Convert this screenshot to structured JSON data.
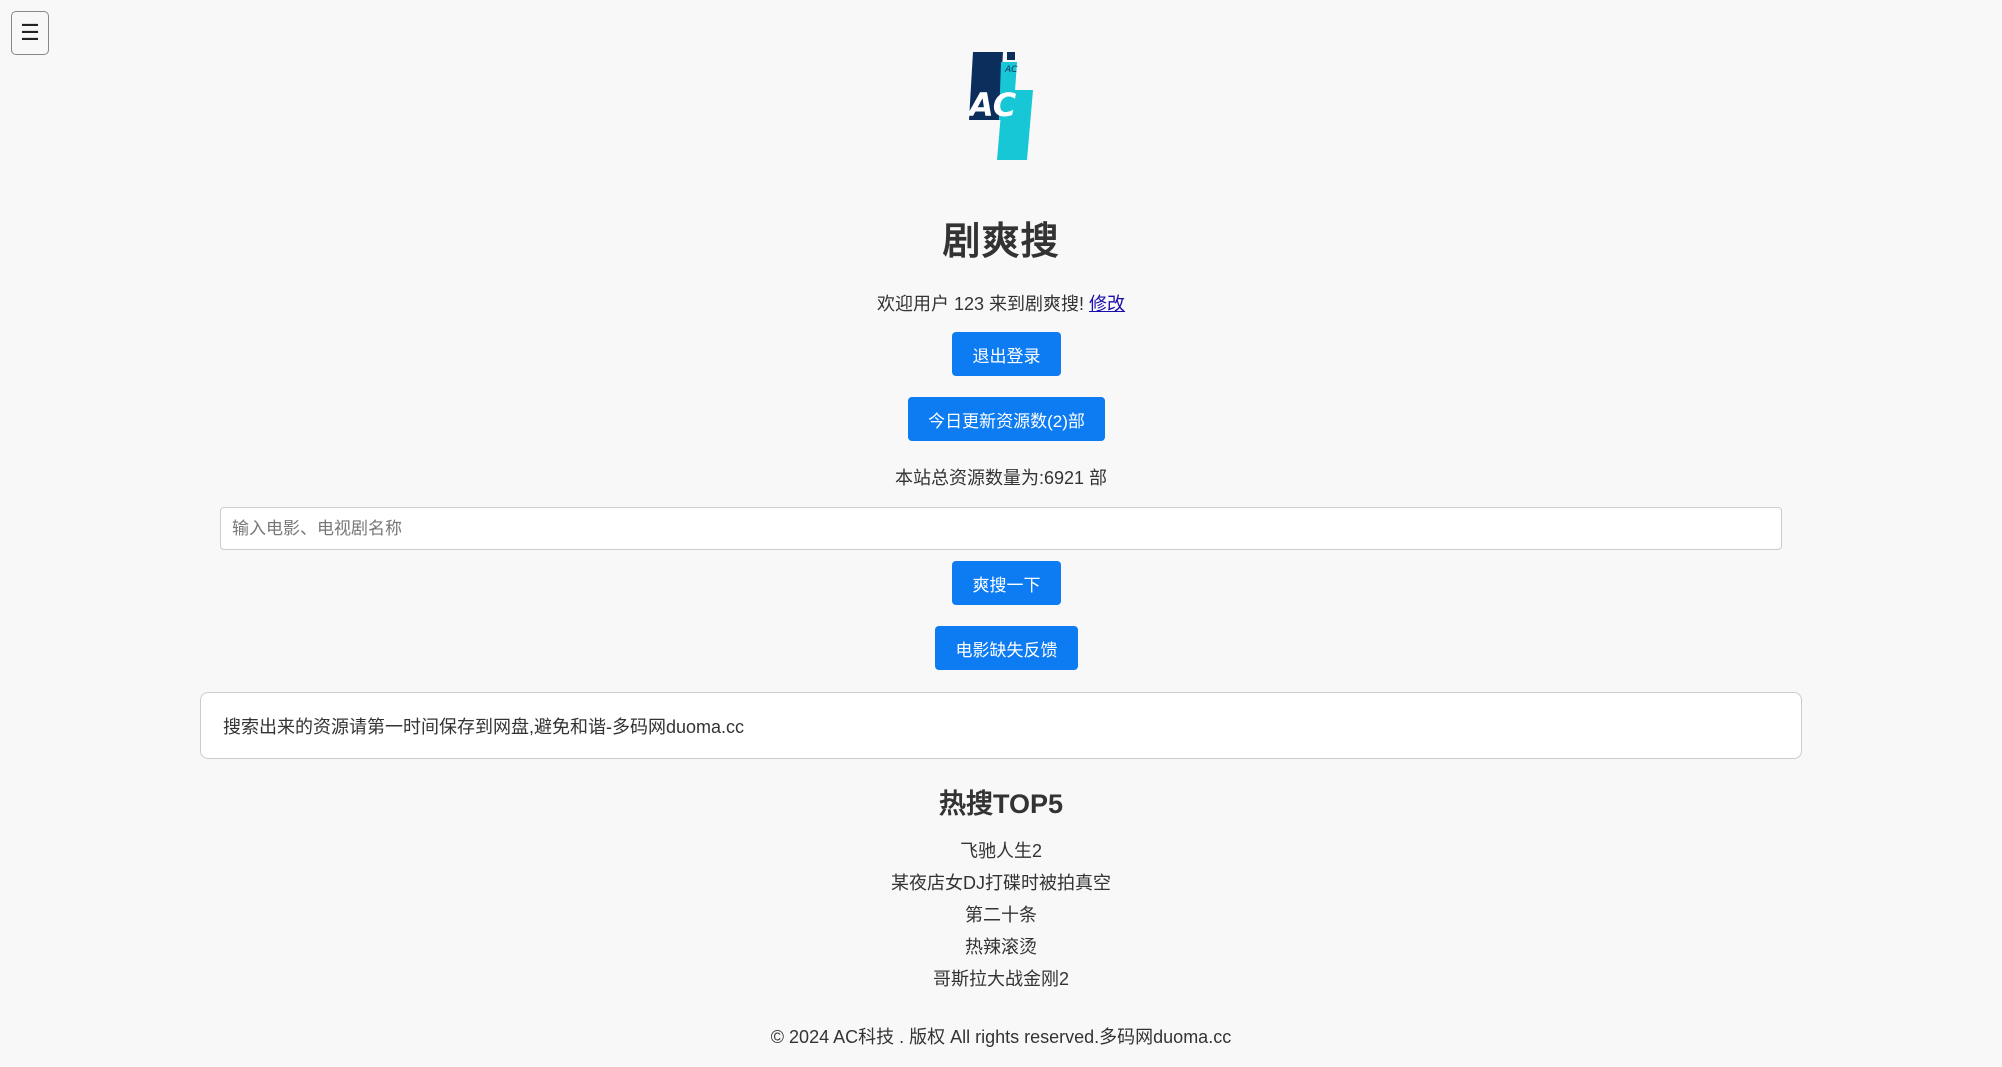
{
  "menu": {
    "icon": "hamburger-menu-icon",
    "glyph": "☰"
  },
  "logo": {
    "text": "AC",
    "small_text": "AC",
    "colors": {
      "dark": "#0b2e5c",
      "teal": "#17c7d6"
    }
  },
  "site_title": "剧爽搜",
  "welcome": {
    "text": "欢迎用户 123 来到剧爽搜!",
    "edit_link": "修改"
  },
  "buttons": {
    "logout": "退出登录",
    "today_updates": "今日更新资源数(2)部",
    "search": "爽搜一下",
    "feedback": "电影缺失反馈"
  },
  "total_resources": "本站总资源数量为:6921 部",
  "search": {
    "placeholder": "输入电影、电视剧名称",
    "value": ""
  },
  "notice": "搜索出来的资源请第一时间保存到网盘,避免和谐-多码网duoma.cc",
  "hot": {
    "title": "热搜TOP5",
    "items": [
      "飞驰人生2",
      "某夜店女DJ打碟时被拍真空",
      "第二十条",
      "热辣滚烫",
      "哥斯拉大战金刚2"
    ]
  },
  "footer": "© 2024 AC科技 . 版权 All rights reserved.多码网duoma.cc",
  "colors": {
    "accent": "#0d7bf2",
    "background": "#f8f8f8",
    "link": "#1a0dab"
  }
}
